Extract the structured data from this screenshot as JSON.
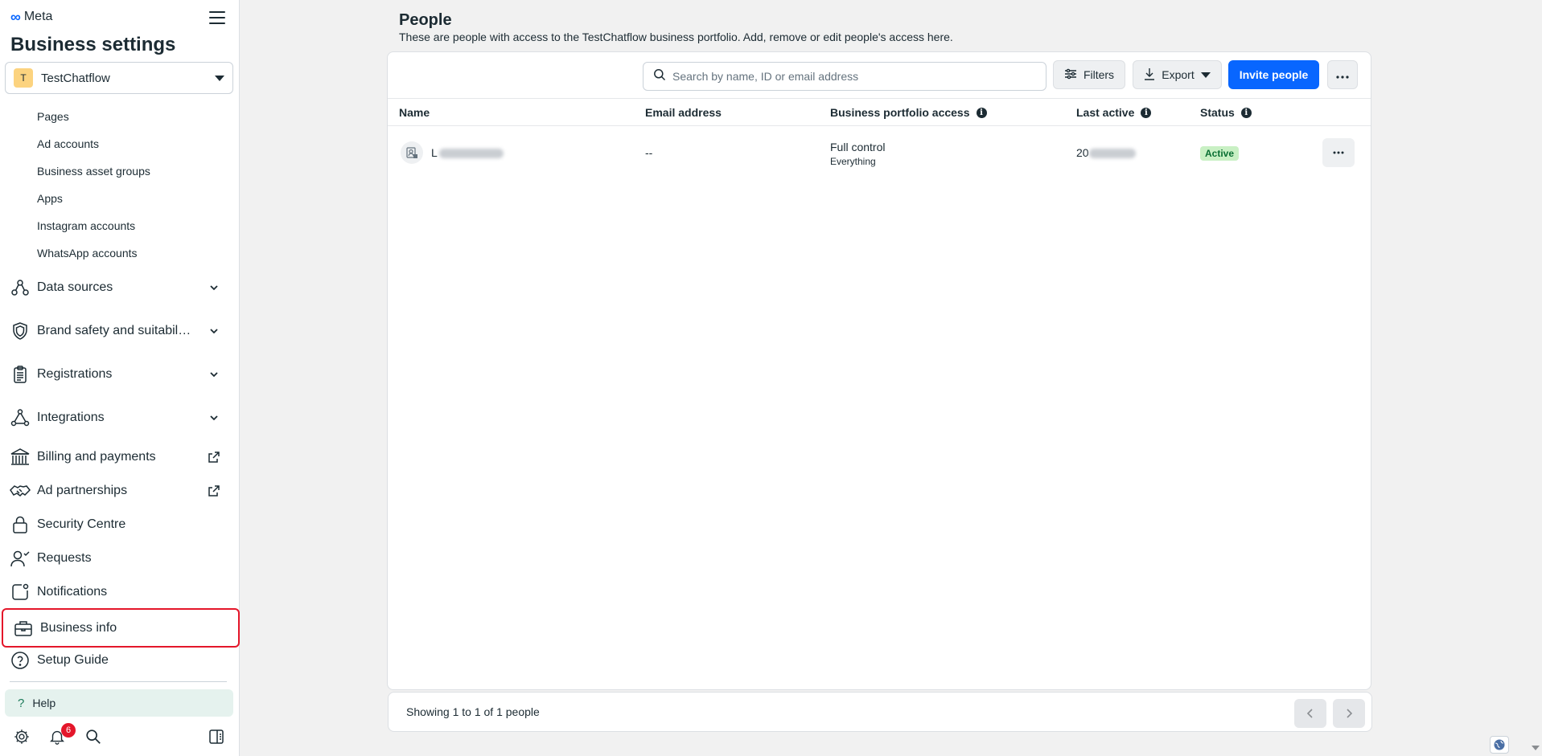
{
  "brand": {
    "logo_text": "Meta"
  },
  "app_title": "Business settings",
  "portfolio": {
    "initial": "T",
    "name": "TestChatflow"
  },
  "sidebar": {
    "sub_items": [
      "Pages",
      "Ad accounts",
      "Business asset groups",
      "Apps",
      "Instagram accounts",
      "WhatsApp accounts"
    ],
    "items": [
      {
        "label": "Data sources",
        "icon": "data-sources-icon",
        "right": "chevron"
      },
      {
        "label": "Brand safety and suitabil…",
        "icon": "shield-icon",
        "right": "chevron"
      },
      {
        "label": "Registrations",
        "icon": "clipboard-icon",
        "right": "chevron"
      },
      {
        "label": "Integrations",
        "icon": "integrations-icon",
        "right": "chevron"
      },
      {
        "label": "Billing and payments",
        "icon": "bank-icon",
        "right": "external"
      },
      {
        "label": "Ad partnerships",
        "icon": "handshake-icon",
        "right": "external"
      },
      {
        "label": "Security Centre",
        "icon": "lock-icon",
        "right": ""
      },
      {
        "label": "Requests",
        "icon": "person-check-icon",
        "right": ""
      },
      {
        "label": "Notifications",
        "icon": "notification-icon",
        "right": ""
      },
      {
        "label": "Business info",
        "icon": "briefcase-icon",
        "right": ""
      },
      {
        "label": "Setup Guide",
        "icon": "question-circle-icon",
        "right": ""
      }
    ],
    "help_label": "Help",
    "notification_count": "6"
  },
  "main": {
    "title": "People",
    "subtitle": "These are people with access to the TestChatflow business portfolio. Add, remove or edit people's access here.",
    "search_placeholder": "Search by name, ID or email address",
    "filters_label": "Filters",
    "export_label": "Export",
    "invite_label": "Invite people",
    "columns": [
      "Name",
      "Email address",
      "Business portfolio access",
      "Last active",
      "Status"
    ],
    "rows": [
      {
        "name_visible": "L",
        "email": "--",
        "access": "Full control",
        "access_detail": "Everything",
        "last_active_visible": "20",
        "status": "Active"
      }
    ],
    "footer_text": "Showing 1 to 1 of 1 people"
  },
  "colors": {
    "accent": "#0866ff",
    "selected_border": "#e4162a",
    "status_green": "#c9f0c4",
    "help_bg": "#e5f2ee"
  }
}
